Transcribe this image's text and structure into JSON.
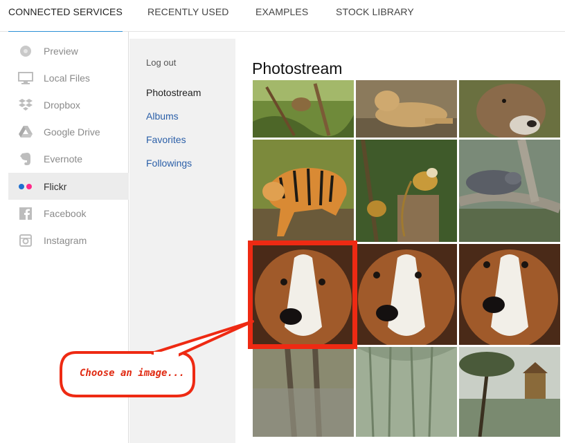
{
  "tabs": [
    {
      "label": "CONNECTED SERVICES",
      "active": true
    },
    {
      "label": "RECENTLY USED",
      "active": false
    },
    {
      "label": "EXAMPLES",
      "active": false
    },
    {
      "label": "STOCK LIBRARY",
      "active": false
    }
  ],
  "sidebar": {
    "items": [
      {
        "label": "Preview",
        "icon": "preview-icon"
      },
      {
        "label": "Local Files",
        "icon": "monitor-icon"
      },
      {
        "label": "Dropbox",
        "icon": "dropbox-icon"
      },
      {
        "label": "Google Drive",
        "icon": "google-drive-icon"
      },
      {
        "label": "Evernote",
        "icon": "evernote-icon"
      },
      {
        "label": "Flickr",
        "icon": "flickr-icon",
        "active": true
      },
      {
        "label": "Facebook",
        "icon": "facebook-icon"
      },
      {
        "label": "Instagram",
        "icon": "instagram-icon"
      }
    ]
  },
  "subnav": {
    "logout": "Log out",
    "current": "Photostream",
    "links": [
      "Albums",
      "Favorites",
      "Followings"
    ]
  },
  "main": {
    "title": "Photostream",
    "photos": [
      {
        "subject": "monkey-in-branches"
      },
      {
        "subject": "lioness-resting"
      },
      {
        "subject": "antelope-head"
      },
      {
        "subject": "tiger-walking"
      },
      {
        "subject": "squirrel-monkeys"
      },
      {
        "subject": "otter-on-log"
      },
      {
        "subject": "sheltie-dog",
        "selected": true
      },
      {
        "subject": "sheltie-dog"
      },
      {
        "subject": "sheltie-dog"
      },
      {
        "subject": "water-reflection"
      },
      {
        "subject": "willow-reflection"
      },
      {
        "subject": "tree-and-playhouse"
      }
    ]
  },
  "callout": {
    "text": "Choose an image..."
  },
  "colors": {
    "accent": "#2a8fd6",
    "highlight": "#ee2a13",
    "link": "#2b5fa8"
  }
}
